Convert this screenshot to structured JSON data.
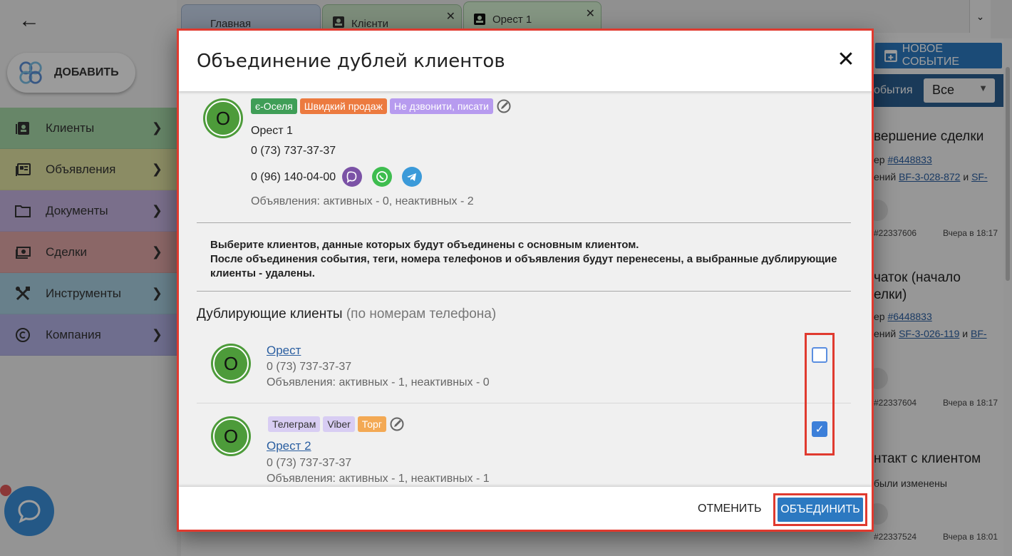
{
  "sidebar": {
    "add_label": "ДОБАВИТЬ",
    "items": [
      {
        "label": "Клиенты"
      },
      {
        "label": "Объявления"
      },
      {
        "label": "Документы"
      },
      {
        "label": "Сделки"
      },
      {
        "label": "Инструменты"
      },
      {
        "label": "Компания"
      }
    ]
  },
  "tabs": [
    {
      "label": "Главная"
    },
    {
      "label": "Клієнти"
    },
    {
      "label": "Орест 1"
    }
  ],
  "right_panel": {
    "new_event_label": "НОВОЕ СОБЫТИЕ",
    "filter_label": "обытия",
    "filter_value": "Все",
    "events": [
      {
        "title": "вершение сделки",
        "line1_prefix": "ер ",
        "line1_link": "#6448833",
        "line2_prefix": "ений ",
        "line2_link": "BF-3-028-872",
        "line2_mid": " и ",
        "line2_link2": "SF-",
        "id": "#22337606",
        "time": "Вчера в 18:17"
      },
      {
        "title": "чаток (начало",
        "title2": "елки)",
        "line1_prefix": "ер ",
        "line1_link": "#6448833",
        "line2_prefix": "ений ",
        "line2_link": "SF-3-026-119",
        "line2_mid": " и ",
        "line2_link2": "BF-",
        "id": "#22337604",
        "time": "Вчера в 18:17"
      },
      {
        "title": "нтакт с клиентом",
        "line1_prefix": "были изменены",
        "id": "#22337524",
        "time": "Вчера в 18:01"
      }
    ]
  },
  "modal": {
    "title": "Объединение дублей клиентов",
    "main_client": {
      "avatar_letter": "О",
      "tags": [
        "є-Оселя",
        "Швидкий продаж",
        "Не дзвонити, писати"
      ],
      "name": "Орест 1",
      "phone1": "0 (73) 737-37-37",
      "phone2": "0 (96) 140-04-00",
      "listings": "Объявления: активных - 0, неактивных - 2"
    },
    "notice_line1": "Выберите клиентов, данные которых будут объединены с основным клиентом.",
    "notice_line2": "После объединения события, теги, номера телефонов и объявления будут перенесены, а выбранные дублирующие клиенты - удалены.",
    "duplicates_title": "Дублирующие клиенты",
    "duplicates_subtitle": "(по номерам телефона)",
    "duplicates": [
      {
        "avatar_letter": "О",
        "name": "Орест",
        "phone": "0 (73) 737-37-37",
        "listings": "Объявления: активных - 1, неактивных - 0",
        "checked": false,
        "tags": []
      },
      {
        "avatar_letter": "О",
        "name": "Орест 2",
        "phone": "0 (73) 737-37-37",
        "listings": "Объявления: активных - 1, неактивных - 1",
        "checked": true,
        "tags": [
          "Телеграм",
          "Viber",
          "Торг"
        ]
      }
    ],
    "cancel_label": "ОТМЕНИТЬ",
    "merge_label": "ОБЪЕДИНИТЬ"
  },
  "colors": {
    "accent": "#2c79c1",
    "highlight": "#e03a2f",
    "avatar": "#4d9b3a"
  }
}
